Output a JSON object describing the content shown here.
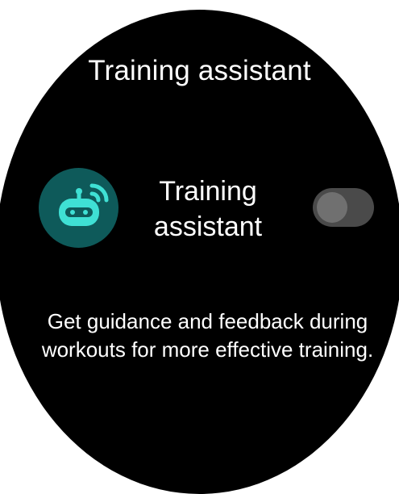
{
  "screen": {
    "title": "Training assistant",
    "feature": {
      "label": "Training assistant",
      "icon": "robot-signal-icon",
      "toggle_on": false
    },
    "description": "Get guidance and feedback during workouts for more effective training."
  },
  "colors": {
    "background": "#000000",
    "icon_circle": "#0e5a5a",
    "icon_accent": "#3fe0d4",
    "toggle_track": "#4a4a4a",
    "toggle_knob": "#707070",
    "text": "#ffffff"
  }
}
